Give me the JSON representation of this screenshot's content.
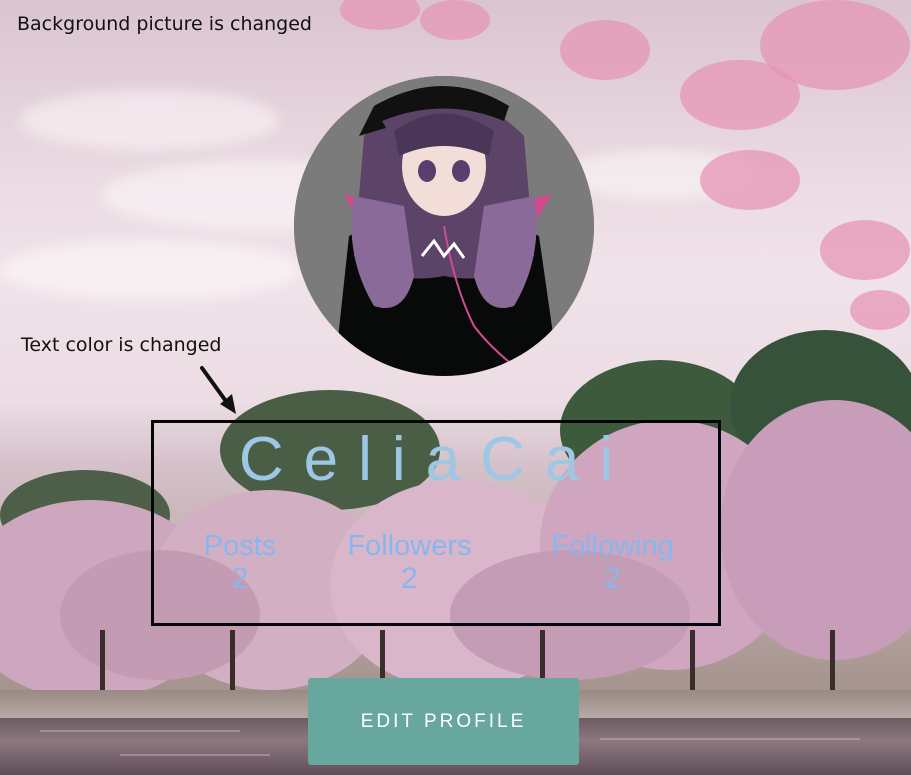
{
  "annotations": {
    "background_note": "Background picture is changed",
    "text_color_note": "Text color is changed"
  },
  "profile": {
    "name": "CeliaCai",
    "stats": [
      {
        "label": "Posts",
        "value": "2"
      },
      {
        "label": "Followers",
        "value": "2"
      },
      {
        "label": "Following",
        "value": "2"
      }
    ],
    "edit_button_label": "EDIT PROFILE"
  },
  "colors": {
    "name_text": "#9dc7e4",
    "stat_text": "#86b7ee",
    "button_bg": "#67a79e",
    "highlight_border": "#050505"
  },
  "icons": {
    "arrow": "arrow-down-right-icon"
  }
}
